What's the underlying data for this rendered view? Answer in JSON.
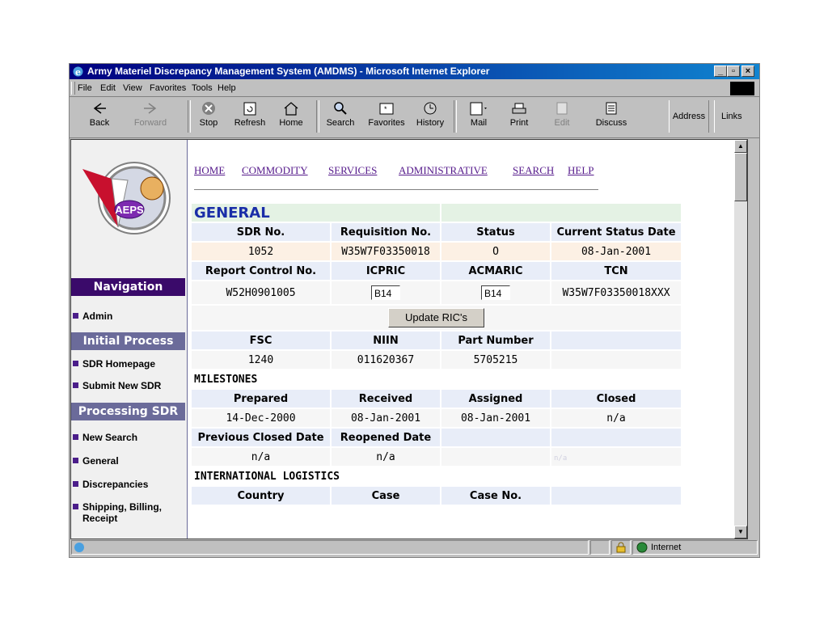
{
  "window": {
    "title": "Army Materiel Discrepancy Management System (AMDMS) - Microsoft Internet Explorer"
  },
  "menu": {
    "items": [
      "File",
      "Edit",
      "View",
      "Favorites",
      "Tools",
      "Help"
    ]
  },
  "toolbar": {
    "buttons": [
      "Back",
      "Forward",
      "Stop",
      "Refresh",
      "Home",
      "Search",
      "Favorites",
      "History",
      "Mail",
      "Print",
      "Edit",
      "Discuss"
    ],
    "address_label": "Address",
    "links_label": "Links"
  },
  "topnav": [
    "HOME",
    "COMMODITY",
    "SERVICES",
    "ADMINISTRATIVE",
    "SEARCH",
    "HELP"
  ],
  "sidebar": {
    "logo_text": "AEPS",
    "navigation_header": "Navigation",
    "admin": "Admin",
    "initial_process_header": "Initial Process",
    "sdr_homepage": "SDR Homepage",
    "submit_new_sdr": "Submit New SDR",
    "processing_header": "Processing SDR",
    "new_search": "New Search",
    "general": "General",
    "discrepancies": "Discrepancies",
    "shipping": "Shipping, Billing, Receipt"
  },
  "general": {
    "title": "GENERAL",
    "headers1": [
      "SDR No.",
      "Requisition No.",
      "Status",
      "Current Status Date"
    ],
    "values1": [
      "1052",
      "W35W7F03350018",
      "O",
      "08-Jan-2001"
    ],
    "headers2": [
      "Report Control No.",
      "ICPRIC",
      "ACMARIC",
      "TCN"
    ],
    "report_control_no": "W52H0901005",
    "icpric": "B14",
    "acmaric": "B14",
    "tcn": "W35W7F03350018XXX",
    "update_button": "Update RIC's",
    "headers3": [
      "FSC",
      "NIIN",
      "Part Number"
    ],
    "values3": [
      "1240",
      "011620367",
      "5705215"
    ]
  },
  "milestones": {
    "title": "MILESTONES",
    "headers1": [
      "Prepared",
      "Received",
      "Assigned",
      "Closed"
    ],
    "values1": [
      "14-Dec-2000",
      "08-Jan-2001",
      "08-Jan-2001",
      "n/a"
    ],
    "headers2": [
      "Previous Closed Date",
      "Reopened Date"
    ],
    "values2": [
      "n/a",
      "n/a"
    ],
    "faded": "n/a"
  },
  "intl": {
    "title": "INTERNATIONAL LOGISTICS",
    "headers": [
      "Country",
      "Case",
      "Case No."
    ]
  },
  "status": {
    "zone": "Internet"
  }
}
